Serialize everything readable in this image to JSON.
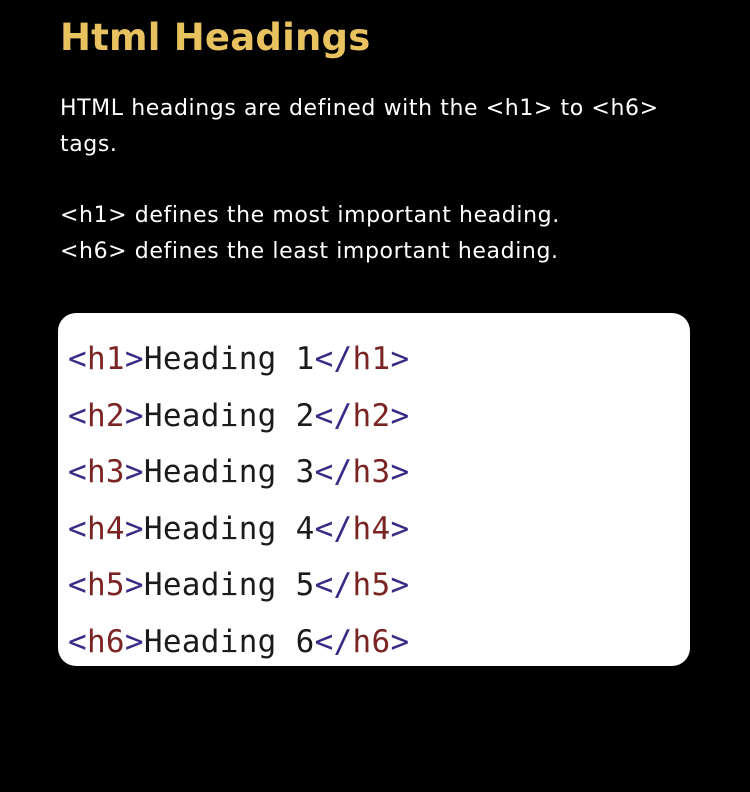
{
  "title": "Html Headings",
  "intro": {
    "line1": "HTML headings are defined with the <h1> to <h6>",
    "line2": "tags."
  },
  "notes": {
    "line1": "<h1> defines the most important heading.",
    "line2": "<h6> defines the least important heading."
  },
  "code": {
    "lines": [
      {
        "open_tag": "h1",
        "text": "Heading 1",
        "close_tag": "h1"
      },
      {
        "open_tag": "h2",
        "text": "Heading 2",
        "close_tag": "h2"
      },
      {
        "open_tag": "h3",
        "text": "Heading 3",
        "close_tag": "h3"
      },
      {
        "open_tag": "h4",
        "text": "Heading 4",
        "close_tag": "h4"
      },
      {
        "open_tag": "h5",
        "text": "Heading 5",
        "close_tag": "h5"
      },
      {
        "open_tag": "h6",
        "text": "Heading 6",
        "close_tag": "h6"
      }
    ]
  },
  "colors": {
    "background": "#000000",
    "title": "#e8c25e",
    "body_text": "#ffffff",
    "code_background": "#ffffff",
    "code_bracket": "#3a2a86",
    "code_tag_name": "#7b2424",
    "code_text": "#1b1b1b"
  }
}
